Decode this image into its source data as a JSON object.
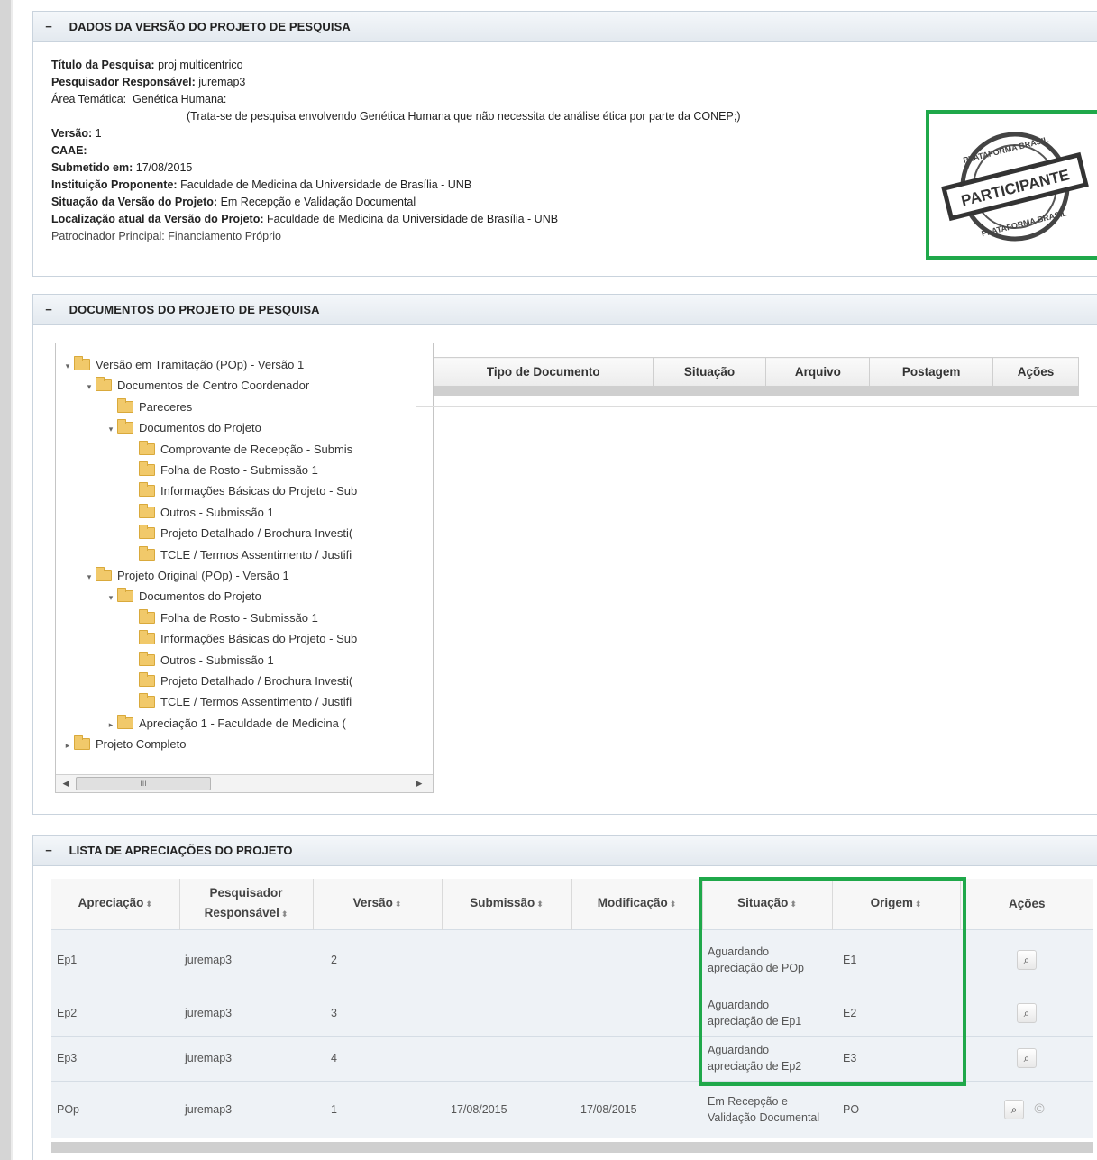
{
  "panel1": {
    "title": "DADOS DA VERSÃO DO PROJETO DE PESQUISA",
    "collapse": "−",
    "fields": {
      "titulo_label": "Título da Pesquisa:",
      "titulo_value": "proj multicentrico",
      "pesquisador_label": "Pesquisador Responsável:",
      "pesquisador_value": "juremap3",
      "area_label": "Área Temática:",
      "area_value": "Genética Humana:",
      "area_note": "(Trata-se de pesquisa envolvendo Genética Humana que não necessita de análise ética por parte da CONEP;)",
      "versao_label": "Versão:",
      "versao_value": "1",
      "caae_label": "CAAE:",
      "caae_value": "",
      "submetido_label": "Submetido em:",
      "submetido_value": "17/08/2015",
      "instituicao_label": "Instituição Proponente:",
      "instituicao_value": "Faculdade de Medicina da Universidade de Brasília - UNB",
      "situacao_label": "Situação da Versão do Projeto:",
      "situacao_value": "Em Recepção e Validação Documental",
      "localizacao_label": "Localização atual da Versão do Projeto:",
      "localizacao_value": "Faculdade de Medicina da Universidade de Brasília - UNB",
      "patrocinador_label": "Patrocinador Principal:",
      "patrocinador_value": "Financiamento Próprio"
    },
    "stamp": {
      "text": "PARTICIPANTE",
      "ring_text": "PLATAFORMA BRASIL"
    }
  },
  "panel2": {
    "title": "DOCUMENTOS DO PROJETO DE PESQUISA",
    "collapse": "−",
    "tree": [
      {
        "level": 0,
        "expanded": true,
        "label": "Versão em Tramitação (POp) - Versão 1"
      },
      {
        "level": 1,
        "expanded": true,
        "label": "Documentos de Centro Coordenador"
      },
      {
        "level": 2,
        "expanded": null,
        "label": "Pareceres"
      },
      {
        "level": 2,
        "expanded": true,
        "label": "Documentos do Projeto"
      },
      {
        "level": 3,
        "expanded": null,
        "label": "Comprovante de Recepção - Submis"
      },
      {
        "level": 3,
        "expanded": null,
        "label": "Folha de Rosto - Submissão 1"
      },
      {
        "level": 3,
        "expanded": null,
        "label": "Informações Básicas do Projeto - Sub"
      },
      {
        "level": 3,
        "expanded": null,
        "label": "Outros - Submissão 1"
      },
      {
        "level": 3,
        "expanded": null,
        "label": "Projeto Detalhado / Brochura Investi("
      },
      {
        "level": 3,
        "expanded": null,
        "label": "TCLE / Termos Assentimento / Justifi"
      },
      {
        "level": 1,
        "expanded": true,
        "label": "Projeto Original (POp) - Versão 1"
      },
      {
        "level": 2,
        "expanded": true,
        "label": "Documentos do Projeto"
      },
      {
        "level": 3,
        "expanded": null,
        "label": "Folha de Rosto - Submissão 1"
      },
      {
        "level": 3,
        "expanded": null,
        "label": "Informações Básicas do Projeto - Sub"
      },
      {
        "level": 3,
        "expanded": null,
        "label": "Outros - Submissão 1"
      },
      {
        "level": 3,
        "expanded": null,
        "label": "Projeto Detalhado / Brochura Investi("
      },
      {
        "level": 3,
        "expanded": null,
        "label": "TCLE / Termos Assentimento / Justifi"
      },
      {
        "level": 2,
        "expanded": false,
        "label": "Apreciação 1 - Faculdade de Medicina ("
      },
      {
        "level": 0,
        "expanded": false,
        "label": "Projeto Completo"
      }
    ],
    "scrollbar_thumb": "III",
    "doc_table_headers": [
      "Tipo de Documento",
      "Situação",
      "Arquivo",
      "Postagem",
      "Ações"
    ]
  },
  "panel3": {
    "title": "LISTA DE APRECIAÇÕES DO PROJETO",
    "collapse": "−",
    "headers": {
      "apreciacao": "Apreciação",
      "pesquisador_1": "Pesquisador",
      "pesquisador_2": "Responsável",
      "versao": "Versão",
      "submissao": "Submissão",
      "modificacao": "Modificação",
      "situacao": "Situação",
      "origem": "Origem",
      "acoes": "Ações",
      "sort_glyph": "⬍"
    },
    "rows": [
      {
        "apreciacao": "Ep1",
        "pesquisador": "juremap3",
        "versao": "2",
        "submissao": "",
        "modificacao": "",
        "situacao": "Aguardando apreciação de POp",
        "origem": "E1"
      },
      {
        "apreciacao": "Ep2",
        "pesquisador": "juremap3",
        "versao": "3",
        "submissao": "",
        "modificacao": "",
        "situacao": "Aguardando apreciação de Ep1",
        "origem": "E2"
      },
      {
        "apreciacao": "Ep3",
        "pesquisador": "juremap3",
        "versao": "4",
        "submissao": "",
        "modificacao": "",
        "situacao": "Aguardando apreciação de Ep2",
        "origem": "E3"
      },
      {
        "apreciacao": "POp",
        "pesquisador": "juremap3",
        "versao": "1",
        "submissao": "17/08/2015",
        "modificacao": "17/08/2015",
        "situacao": "Em Recepção e Validação Documental",
        "origem": "PO"
      }
    ],
    "icons": {
      "search": "⌕",
      "copyright": "©"
    }
  },
  "colors": {
    "highlight": "#1fa84a",
    "header_bg": "#e3e9ef",
    "row_bg": "#eef2f6"
  }
}
